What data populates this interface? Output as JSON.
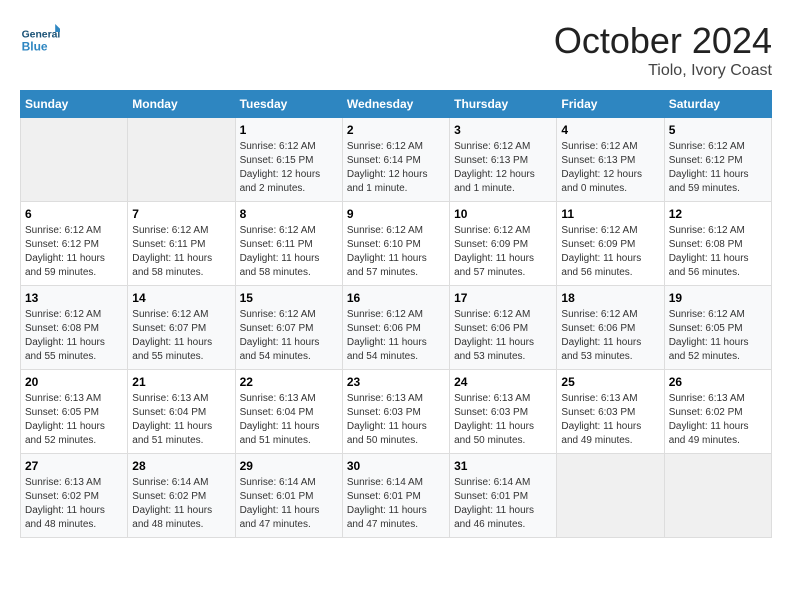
{
  "header": {
    "logo_general": "General",
    "logo_blue": "Blue",
    "title": "October 2024",
    "location": "Tiolo, Ivory Coast"
  },
  "columns": [
    "Sunday",
    "Monday",
    "Tuesday",
    "Wednesday",
    "Thursday",
    "Friday",
    "Saturday"
  ],
  "weeks": [
    [
      {
        "day": "",
        "sunrise": "",
        "sunset": "",
        "daylight": ""
      },
      {
        "day": "",
        "sunrise": "",
        "sunset": "",
        "daylight": ""
      },
      {
        "day": "1",
        "sunrise": "Sunrise: 6:12 AM",
        "sunset": "Sunset: 6:15 PM",
        "daylight": "Daylight: 12 hours and 2 minutes."
      },
      {
        "day": "2",
        "sunrise": "Sunrise: 6:12 AM",
        "sunset": "Sunset: 6:14 PM",
        "daylight": "Daylight: 12 hours and 1 minute."
      },
      {
        "day": "3",
        "sunrise": "Sunrise: 6:12 AM",
        "sunset": "Sunset: 6:13 PM",
        "daylight": "Daylight: 12 hours and 1 minute."
      },
      {
        "day": "4",
        "sunrise": "Sunrise: 6:12 AM",
        "sunset": "Sunset: 6:13 PM",
        "daylight": "Daylight: 12 hours and 0 minutes."
      },
      {
        "day": "5",
        "sunrise": "Sunrise: 6:12 AM",
        "sunset": "Sunset: 6:12 PM",
        "daylight": "Daylight: 11 hours and 59 minutes."
      }
    ],
    [
      {
        "day": "6",
        "sunrise": "Sunrise: 6:12 AM",
        "sunset": "Sunset: 6:12 PM",
        "daylight": "Daylight: 11 hours and 59 minutes."
      },
      {
        "day": "7",
        "sunrise": "Sunrise: 6:12 AM",
        "sunset": "Sunset: 6:11 PM",
        "daylight": "Daylight: 11 hours and 58 minutes."
      },
      {
        "day": "8",
        "sunrise": "Sunrise: 6:12 AM",
        "sunset": "Sunset: 6:11 PM",
        "daylight": "Daylight: 11 hours and 58 minutes."
      },
      {
        "day": "9",
        "sunrise": "Sunrise: 6:12 AM",
        "sunset": "Sunset: 6:10 PM",
        "daylight": "Daylight: 11 hours and 57 minutes."
      },
      {
        "day": "10",
        "sunrise": "Sunrise: 6:12 AM",
        "sunset": "Sunset: 6:09 PM",
        "daylight": "Daylight: 11 hours and 57 minutes."
      },
      {
        "day": "11",
        "sunrise": "Sunrise: 6:12 AM",
        "sunset": "Sunset: 6:09 PM",
        "daylight": "Daylight: 11 hours and 56 minutes."
      },
      {
        "day": "12",
        "sunrise": "Sunrise: 6:12 AM",
        "sunset": "Sunset: 6:08 PM",
        "daylight": "Daylight: 11 hours and 56 minutes."
      }
    ],
    [
      {
        "day": "13",
        "sunrise": "Sunrise: 6:12 AM",
        "sunset": "Sunset: 6:08 PM",
        "daylight": "Daylight: 11 hours and 55 minutes."
      },
      {
        "day": "14",
        "sunrise": "Sunrise: 6:12 AM",
        "sunset": "Sunset: 6:07 PM",
        "daylight": "Daylight: 11 hours and 55 minutes."
      },
      {
        "day": "15",
        "sunrise": "Sunrise: 6:12 AM",
        "sunset": "Sunset: 6:07 PM",
        "daylight": "Daylight: 11 hours and 54 minutes."
      },
      {
        "day": "16",
        "sunrise": "Sunrise: 6:12 AM",
        "sunset": "Sunset: 6:06 PM",
        "daylight": "Daylight: 11 hours and 54 minutes."
      },
      {
        "day": "17",
        "sunrise": "Sunrise: 6:12 AM",
        "sunset": "Sunset: 6:06 PM",
        "daylight": "Daylight: 11 hours and 53 minutes."
      },
      {
        "day": "18",
        "sunrise": "Sunrise: 6:12 AM",
        "sunset": "Sunset: 6:06 PM",
        "daylight": "Daylight: 11 hours and 53 minutes."
      },
      {
        "day": "19",
        "sunrise": "Sunrise: 6:12 AM",
        "sunset": "Sunset: 6:05 PM",
        "daylight": "Daylight: 11 hours and 52 minutes."
      }
    ],
    [
      {
        "day": "20",
        "sunrise": "Sunrise: 6:13 AM",
        "sunset": "Sunset: 6:05 PM",
        "daylight": "Daylight: 11 hours and 52 minutes."
      },
      {
        "day": "21",
        "sunrise": "Sunrise: 6:13 AM",
        "sunset": "Sunset: 6:04 PM",
        "daylight": "Daylight: 11 hours and 51 minutes."
      },
      {
        "day": "22",
        "sunrise": "Sunrise: 6:13 AM",
        "sunset": "Sunset: 6:04 PM",
        "daylight": "Daylight: 11 hours and 51 minutes."
      },
      {
        "day": "23",
        "sunrise": "Sunrise: 6:13 AM",
        "sunset": "Sunset: 6:03 PM",
        "daylight": "Daylight: 11 hours and 50 minutes."
      },
      {
        "day": "24",
        "sunrise": "Sunrise: 6:13 AM",
        "sunset": "Sunset: 6:03 PM",
        "daylight": "Daylight: 11 hours and 50 minutes."
      },
      {
        "day": "25",
        "sunrise": "Sunrise: 6:13 AM",
        "sunset": "Sunset: 6:03 PM",
        "daylight": "Daylight: 11 hours and 49 minutes."
      },
      {
        "day": "26",
        "sunrise": "Sunrise: 6:13 AM",
        "sunset": "Sunset: 6:02 PM",
        "daylight": "Daylight: 11 hours and 49 minutes."
      }
    ],
    [
      {
        "day": "27",
        "sunrise": "Sunrise: 6:13 AM",
        "sunset": "Sunset: 6:02 PM",
        "daylight": "Daylight: 11 hours and 48 minutes."
      },
      {
        "day": "28",
        "sunrise": "Sunrise: 6:14 AM",
        "sunset": "Sunset: 6:02 PM",
        "daylight": "Daylight: 11 hours and 48 minutes."
      },
      {
        "day": "29",
        "sunrise": "Sunrise: 6:14 AM",
        "sunset": "Sunset: 6:01 PM",
        "daylight": "Daylight: 11 hours and 47 minutes."
      },
      {
        "day": "30",
        "sunrise": "Sunrise: 6:14 AM",
        "sunset": "Sunset: 6:01 PM",
        "daylight": "Daylight: 11 hours and 47 minutes."
      },
      {
        "day": "31",
        "sunrise": "Sunrise: 6:14 AM",
        "sunset": "Sunset: 6:01 PM",
        "daylight": "Daylight: 11 hours and 46 minutes."
      },
      {
        "day": "",
        "sunrise": "",
        "sunset": "",
        "daylight": ""
      },
      {
        "day": "",
        "sunrise": "",
        "sunset": "",
        "daylight": ""
      }
    ]
  ]
}
